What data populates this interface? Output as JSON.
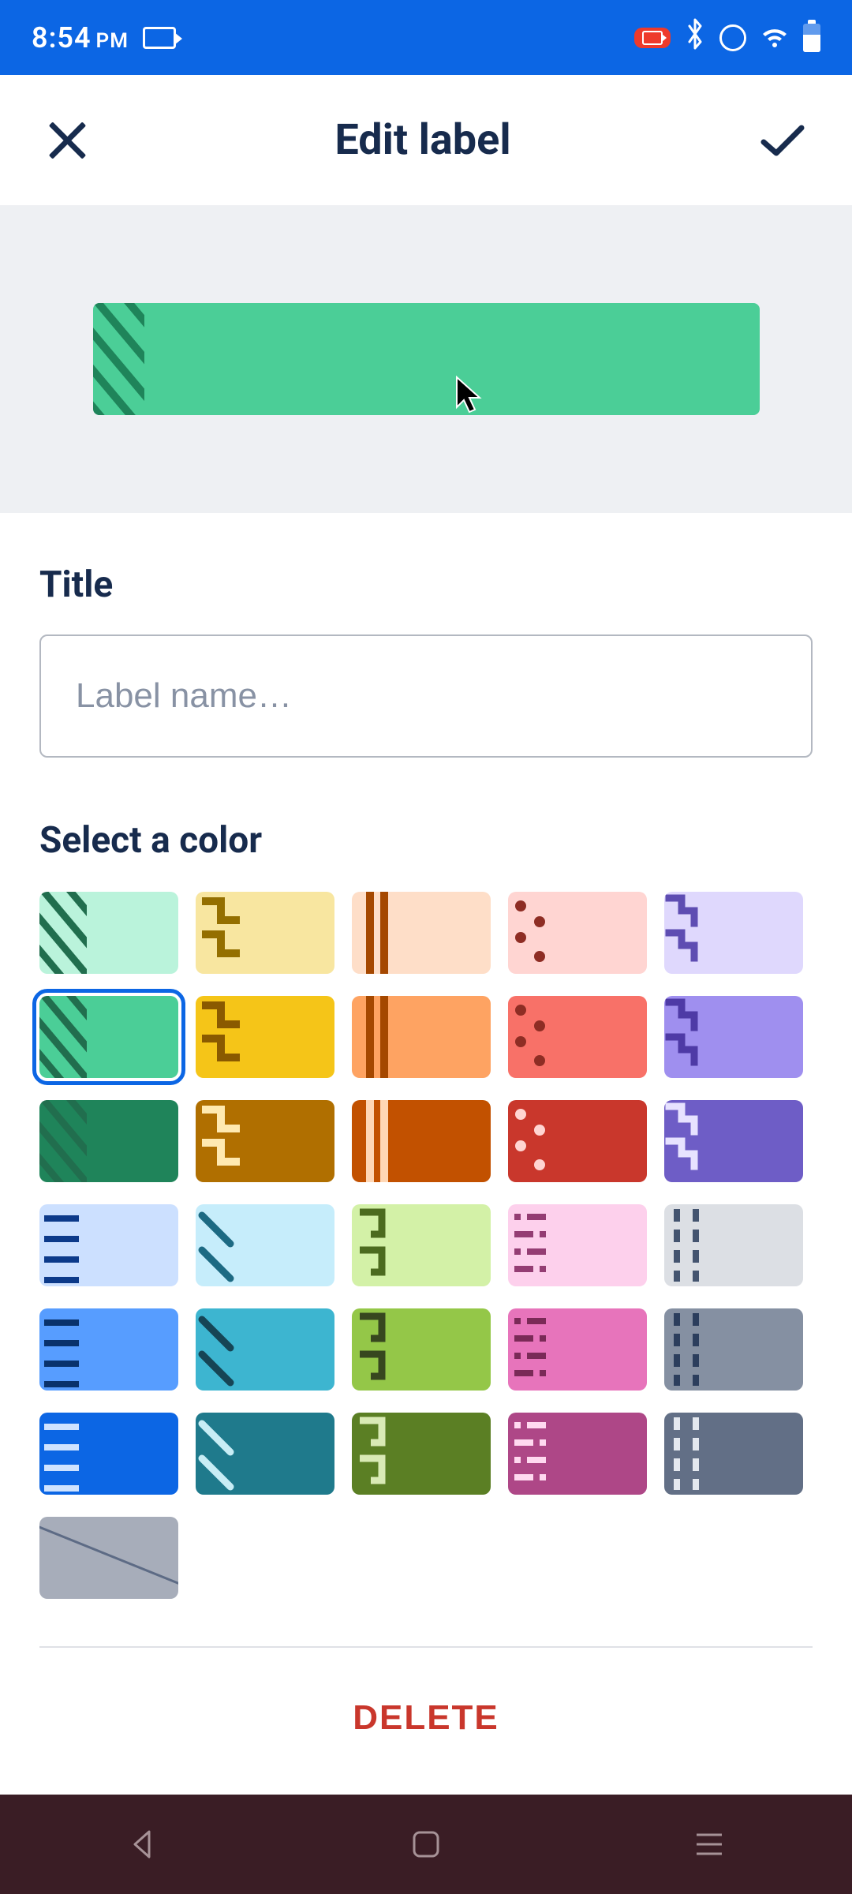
{
  "status": {
    "time": "8:54",
    "ampm": "PM"
  },
  "header": {
    "title": "Edit label"
  },
  "preview": {
    "color": "#4bce97",
    "accent": "#1f845a"
  },
  "form": {
    "title_label": "Title",
    "name_placeholder": "Label name…",
    "name_value": "",
    "select_color_label": "Select a color"
  },
  "colors": [
    {
      "id": "green-light",
      "bg": "#baf3db",
      "accent": "#216e4e",
      "pattern": "diag",
      "selected": false
    },
    {
      "id": "yellow-light",
      "bg": "#f8e6a0",
      "accent": "#946f00",
      "pattern": "step",
      "selected": false
    },
    {
      "id": "orange-light",
      "bg": "#fedec8",
      "accent": "#a54800",
      "pattern": "bars",
      "selected": false
    },
    {
      "id": "red-light",
      "bg": "#ffd5d2",
      "accent": "#8e2d24",
      "pattern": "dots",
      "selected": false
    },
    {
      "id": "purple-light",
      "bg": "#dfd8fd",
      "accent": "#5e4db2",
      "pattern": "zig",
      "selected": false
    },
    {
      "id": "green",
      "bg": "#4bce97",
      "accent": "#1f845a",
      "pattern": "diag",
      "selected": true
    },
    {
      "id": "yellow",
      "bg": "#f5c518",
      "accent": "#8a5a00",
      "pattern": "step",
      "selected": false
    },
    {
      "id": "orange",
      "bg": "#fea362",
      "accent": "#a54800",
      "pattern": "bars",
      "selected": false
    },
    {
      "id": "red",
      "bg": "#f87168",
      "accent": "#8e2d24",
      "pattern": "dots",
      "selected": false
    },
    {
      "id": "purple",
      "bg": "#9f8fef",
      "accent": "#4e3aa6",
      "pattern": "zig",
      "selected": false
    },
    {
      "id": "green-dark",
      "bg": "#1f845a",
      "accent": "#d3f1e0",
      "pattern": "diag",
      "selected": false
    },
    {
      "id": "yellow-dark",
      "bg": "#b06f00",
      "accent": "#ffe9b0",
      "pattern": "step",
      "selected": false
    },
    {
      "id": "orange-dark",
      "bg": "#c25100",
      "accent": "#ffd7b5",
      "pattern": "bars",
      "selected": false
    },
    {
      "id": "red-dark",
      "bg": "#c9372c",
      "accent": "#ffd5d2",
      "pattern": "dots",
      "selected": false
    },
    {
      "id": "purple-dark",
      "bg": "#6e5dc6",
      "accent": "#e7e2ff",
      "pattern": "zig",
      "selected": false
    },
    {
      "id": "blue-light",
      "bg": "#cce0ff",
      "accent": "#0c3a8a",
      "pattern": "hlines",
      "selected": false
    },
    {
      "id": "sky-light",
      "bg": "#c6edfb",
      "accent": "#1d6a83",
      "pattern": "slash",
      "selected": false
    },
    {
      "id": "lime-light",
      "bg": "#d3f1a7",
      "accent": "#4c6b1f",
      "pattern": "squares",
      "selected": false
    },
    {
      "id": "pink-light",
      "bg": "#fdd0ec",
      "accent": "#943d73",
      "pattern": "morse",
      "selected": false
    },
    {
      "id": "gray-light",
      "bg": "#dcdfe4",
      "accent": "#44546f",
      "pattern": "dash",
      "selected": false
    },
    {
      "id": "blue",
      "bg": "#579dff",
      "accent": "#09326c",
      "pattern": "hlines",
      "selected": false
    },
    {
      "id": "sky",
      "bg": "#3db5d0",
      "accent": "#164555",
      "pattern": "slash",
      "selected": false
    },
    {
      "id": "lime",
      "bg": "#94c748",
      "accent": "#37471f",
      "pattern": "squares",
      "selected": false
    },
    {
      "id": "pink",
      "bg": "#e774bb",
      "accent": "#7a2a57",
      "pattern": "morse",
      "selected": false
    },
    {
      "id": "gray",
      "bg": "#8590a2",
      "accent": "#2c3e5d",
      "pattern": "dash",
      "selected": false
    },
    {
      "id": "blue-dark",
      "bg": "#0c66e4",
      "accent": "#cfe3ff",
      "pattern": "hlines",
      "selected": false
    },
    {
      "id": "sky-dark",
      "bg": "#1f7a8c",
      "accent": "#c8edf5",
      "pattern": "slash",
      "selected": false
    },
    {
      "id": "lime-dark",
      "bg": "#5b7f24",
      "accent": "#d9eab5",
      "pattern": "squares",
      "selected": false
    },
    {
      "id": "pink-dark",
      "bg": "#ae4787",
      "accent": "#ffd9f0",
      "pattern": "morse",
      "selected": false
    },
    {
      "id": "gray-dark",
      "bg": "#626f86",
      "accent": "#e4e8ef",
      "pattern": "dash",
      "selected": false
    }
  ],
  "actions": {
    "delete": "DELETE"
  }
}
